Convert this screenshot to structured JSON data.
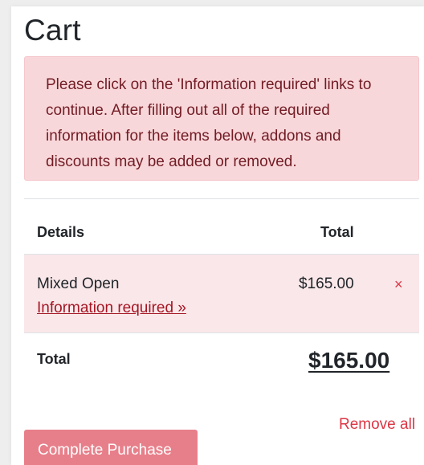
{
  "page": {
    "title": "Cart"
  },
  "alert": {
    "message": "Please click on the 'Information required' links to continue. After filling out all of the required information for the items below, addons and discounts may be added or removed."
  },
  "table": {
    "headers": {
      "details": "Details",
      "total": "Total"
    },
    "items": [
      {
        "name": "Mixed Open",
        "link_text": "Information required »",
        "price": "$165.00",
        "remove_symbol": "×"
      }
    ],
    "summary": {
      "label": "Total",
      "amount": "$165.00"
    }
  },
  "actions": {
    "remove_all": "Remove all",
    "complete_purchase": "Complete Purchase"
  },
  "colors": {
    "alert_bg": "#f8d7da",
    "alert_text": "#721c24",
    "danger": "#dc3545",
    "button_bg": "#e77f8a"
  }
}
